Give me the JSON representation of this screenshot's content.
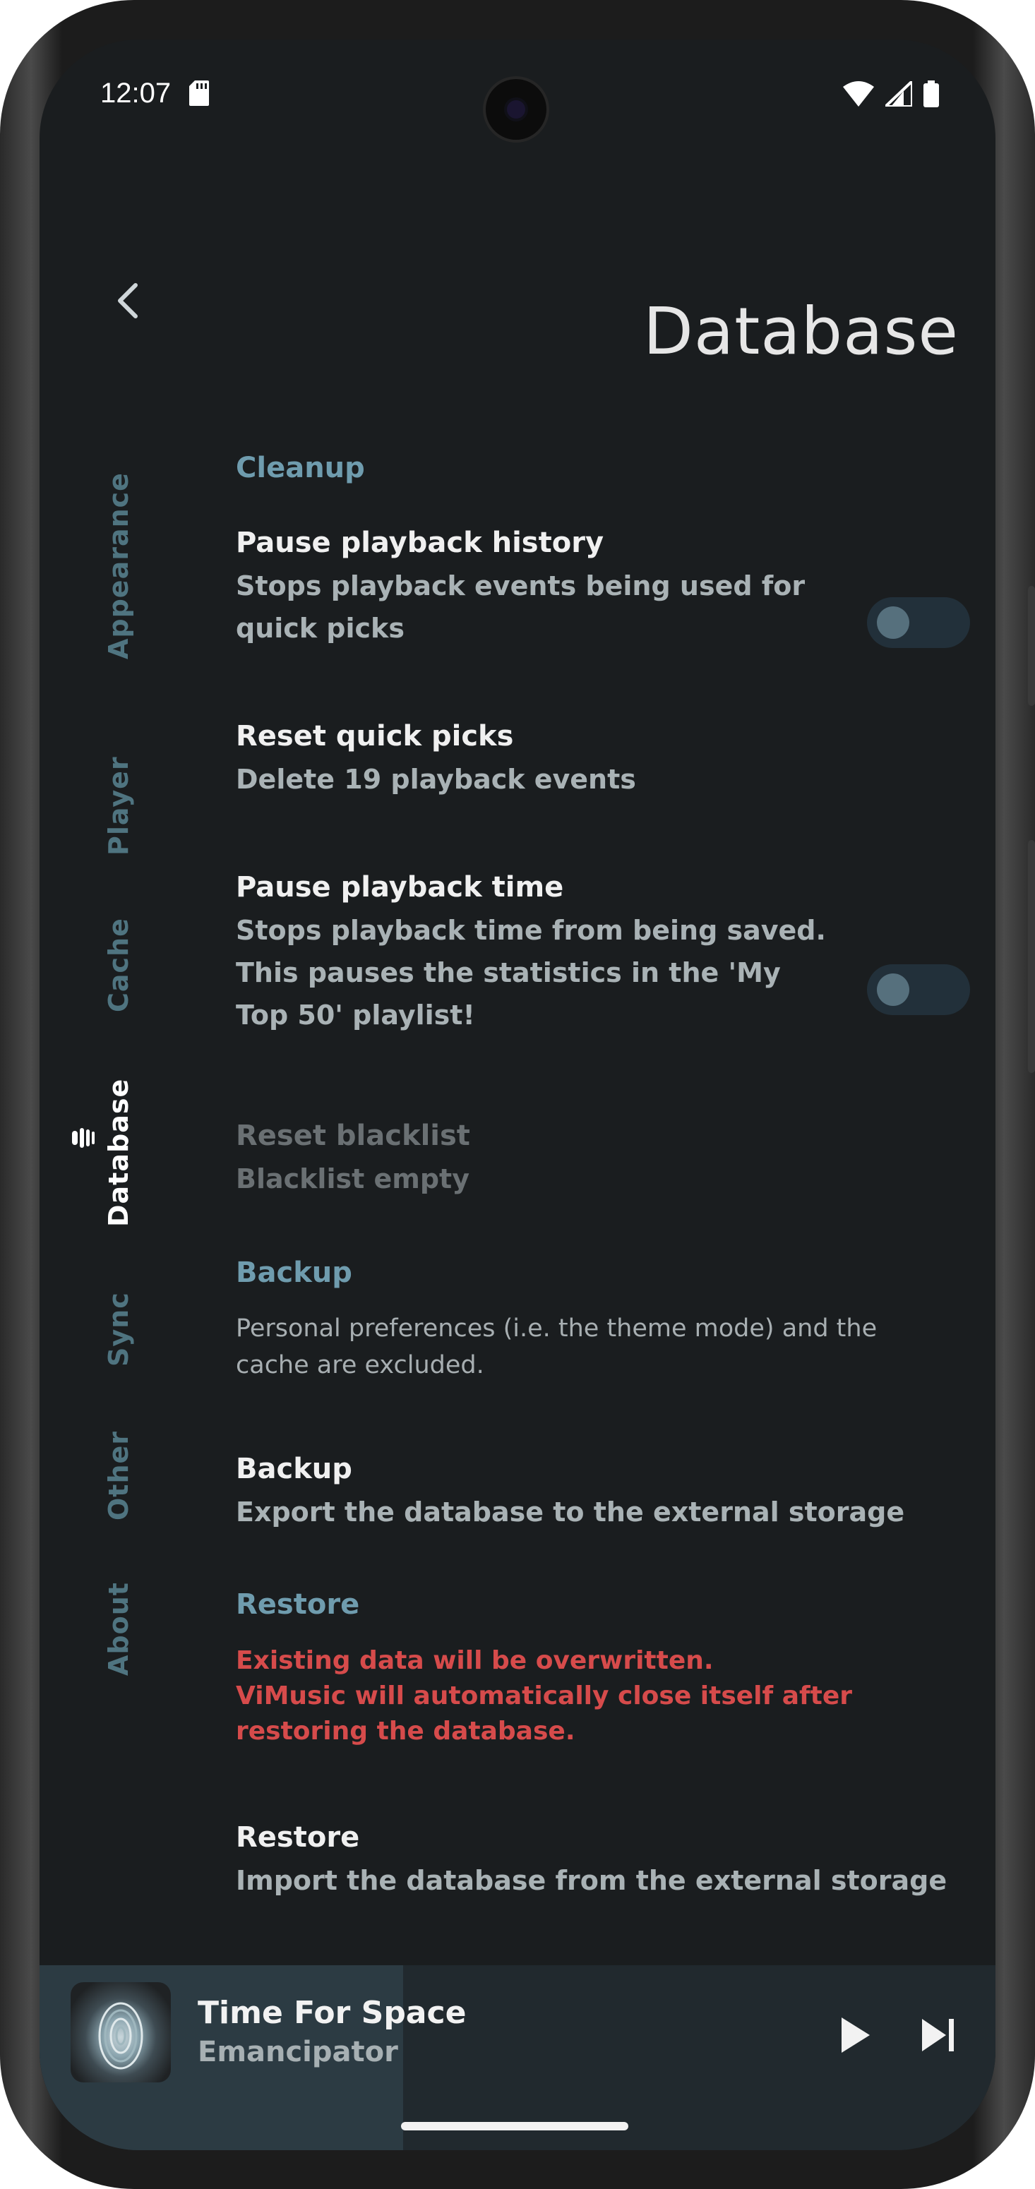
{
  "status_bar": {
    "time": "12:07",
    "sd_card_icon": "sd-card-icon",
    "wifi_icon": "wifi-icon",
    "signal_icon": "signal-icon",
    "battery_icon": "battery-icon"
  },
  "header": {
    "back_icon": "chevron-left-icon",
    "title": "Database"
  },
  "nav_rail": {
    "items": [
      {
        "label": "Appearance",
        "active": false
      },
      {
        "label": "Player",
        "active": false
      },
      {
        "label": "Cache",
        "active": false
      },
      {
        "label": "Database",
        "active": true
      },
      {
        "label": "Sync",
        "active": false
      },
      {
        "label": "Other",
        "active": false
      },
      {
        "label": "About",
        "active": false
      }
    ],
    "active_icon": "database-icon"
  },
  "sections": {
    "cleanup": {
      "title": "Cleanup",
      "pause_history": {
        "title": "Pause playback history",
        "text": "Stops playback events being used for quick picks",
        "toggle_on": false
      },
      "reset_quick_picks": {
        "title": "Reset quick picks",
        "text": "Delete 19 playback events"
      },
      "pause_time": {
        "title": "Pause playback time",
        "text": "Stops playback time from being saved. This pauses the statistics in the 'My Top 50' playlist!",
        "toggle_on": false
      },
      "reset_blacklist": {
        "title": "Reset blacklist",
        "text": "Blacklist empty",
        "disabled": true
      }
    },
    "backup": {
      "title": "Backup",
      "note": "Personal preferences (i.e. the theme mode) and the cache are excluded.",
      "item": {
        "title": "Backup",
        "text": "Export the database to the external storage"
      }
    },
    "restore": {
      "title": "Restore",
      "warning_line1": "Existing data will be overwritten.",
      "warning_line2": "ViMusic will automatically close itself after restoring the database.",
      "item": {
        "title": "Restore",
        "text": "Import the database from the external storage"
      }
    }
  },
  "mini_player": {
    "track_title": "Time For Space",
    "artist": "Emancipator",
    "progress": 0.38,
    "play_icon": "play-icon",
    "next_icon": "skip-next-icon"
  },
  "colors": {
    "background": "#1a1d1f",
    "accent": "#6f9cae",
    "warning": "#d64b4b",
    "nav_inactive": "#4f7480"
  }
}
